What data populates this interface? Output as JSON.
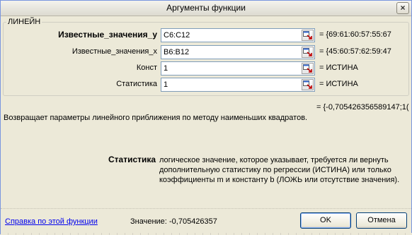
{
  "window": {
    "title": "Аргументы функции",
    "close_glyph": "×"
  },
  "function_group": {
    "name": "ЛИНЕЙН",
    "args": [
      {
        "label": "Известные_значения_y",
        "value": "C6:C12",
        "result": "= {69:61:60:57:55:67",
        "bold": true
      },
      {
        "label": "Известные_значения_x",
        "value": "B6:B12",
        "result": "= {45:60:57:62:59:47",
        "bold": false
      },
      {
        "label": "Конст",
        "value": "1",
        "result": "= ИСТИНА",
        "bold": false
      },
      {
        "label": "Статистика",
        "value": "1",
        "result": "= ИСТИНА",
        "bold": false
      }
    ]
  },
  "total_result": "= {-0,705426356589147;1(",
  "description": "Возвращает параметры линейного приближения по методу наименьших квадратов.",
  "help": {
    "arg_name": "Статистика",
    "text": "логическое значение, которое указывает, требуется ли вернуть дополнительную статистику по регрессии (ИСТИНА) или только коэффициенты m и константу b (ЛОЖЬ или отсутствие значения)."
  },
  "footer": {
    "help_link": "Справка по этой функции",
    "value_label": "Значение:",
    "value": "-0,705426357",
    "ok_label": "OK",
    "cancel_label": "Отмена"
  },
  "icons": {
    "ref_button": "collapse-dialog-icon"
  }
}
